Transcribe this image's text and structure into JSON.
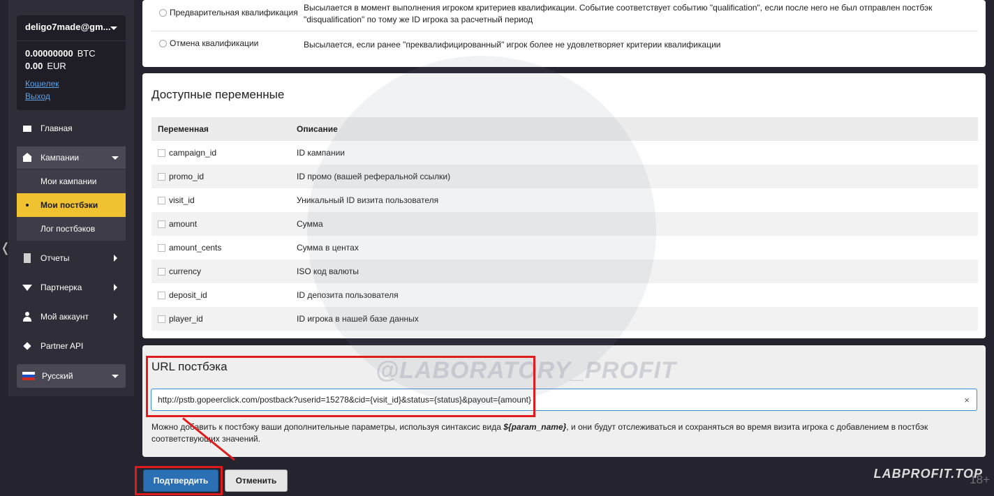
{
  "account": {
    "email": "deligo7made@gm...",
    "btc_amount": "0.00000000",
    "btc_currency": "BTC",
    "eur_amount": "0.00",
    "eur_currency": "EUR",
    "wallet_link": "Кошелек",
    "logout_link": "Выход"
  },
  "nav": {
    "home": "Главная",
    "campaigns": "Кампании",
    "my_campaigns": "Мои кампании",
    "my_postbacks": "Мои постбэки",
    "postback_log": "Лог постбэков",
    "reports": "Отчеты",
    "partner": "Партнерка",
    "my_account": "Мой аккаунт",
    "partner_api": "Partner API",
    "language": "Русский"
  },
  "events": [
    {
      "name": "Предварительная квалификация",
      "desc": "Высылается в момент выполнения игроком критериев квалификации. Событие соответствует событию \"qualification\", если после него не был отправлен постбэк \"disqualification\" по тому же ID игрока за расчетный период"
    },
    {
      "name": "Отмена квалификации",
      "desc": "Высылается, если ранее \"преквалифицированный\" игрок более не удовлетворяет критерии квалификации"
    }
  ],
  "variables": {
    "title": "Доступные переменные",
    "col_variable": "Переменная",
    "col_description": "Описание",
    "rows": [
      {
        "name": "campaign_id",
        "desc": "ID кампании"
      },
      {
        "name": "promo_id",
        "desc": "ID промо (вашей реферальной ссылки)"
      },
      {
        "name": "visit_id",
        "desc": "Уникальный ID визита пользователя"
      },
      {
        "name": "amount",
        "desc": "Сумма"
      },
      {
        "name": "amount_cents",
        "desc": "Сумма в центах"
      },
      {
        "name": "currency",
        "desc": "ISO код валюты"
      },
      {
        "name": "deposit_id",
        "desc": "ID депозита пользователя"
      },
      {
        "name": "player_id",
        "desc": "ID игрока в нашей базе данных"
      }
    ]
  },
  "postback_url": {
    "title": "URL постбэка",
    "value": "http://pstb.gopeerclick.com/postback?userid=15278&cid={visit_id}&status={status}&payout={amount}",
    "clear": "×",
    "hint_before": "Можно добавить к постбэку ваши дополнительные параметры, используя синтаксис вида ",
    "hint_syntax": "${param_name}",
    "hint_after": ", и они будут отслеживаться и сохраняться во время визита игрока с добавлением в постбэк соответствующих значений."
  },
  "buttons": {
    "confirm": "Подтвердить",
    "cancel": "Отменить"
  },
  "overlay": {
    "watermark": "@LABORATORY_PROFIT",
    "brand": "LABPROFIT.TOP",
    "age": "18+"
  },
  "colors": {
    "accent": "#f0c232",
    "primary_button": "#2b6fb5",
    "highlight": "#e01b1b"
  }
}
